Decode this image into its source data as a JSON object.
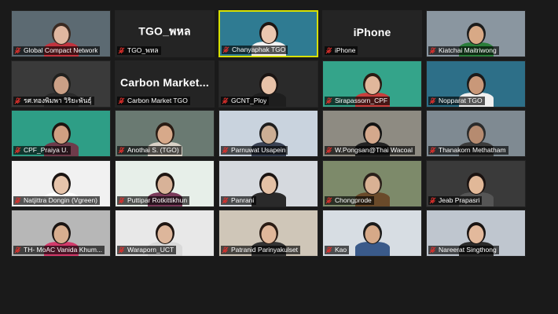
{
  "meeting": {
    "participants": [
      {
        "name": "Global Compact Network",
        "type": "video",
        "bg": "#5c6a72",
        "skin": "#e0b7a0",
        "hair": "#3a2a22",
        "shirt": "#c2333e",
        "muted": true
      },
      {
        "name": "TGO_พหล",
        "type": "name",
        "display": "TGO_พหล",
        "muted": true
      },
      {
        "name": "Chanyaphak TGO",
        "type": "video",
        "bg": "#2f7b92",
        "skin": "#eac7b0",
        "hair": "#1d1512",
        "shirt": "#f2f2f2",
        "muted": true,
        "speaking": true
      },
      {
        "name": "iPhone",
        "type": "name",
        "display": "iPhone",
        "muted": true
      },
      {
        "name": "Kiatchai Maitriwong",
        "type": "video",
        "bg": "#8a96a0",
        "skin": "#d8a986",
        "hair": "#1c1c1c",
        "shirt": "#2a7e3a",
        "muted": true
      },
      {
        "name": "รศ.ทองพิมพา วิริยะพันธุ์",
        "type": "video",
        "bg": "#3a3a3a",
        "skin": "#cba086",
        "hair": "#20201e",
        "shirt": "#2a2a2a",
        "muted": true
      },
      {
        "name": "Carbon Market TGO",
        "type": "name",
        "display": "Carbon  Market...",
        "muted": true
      },
      {
        "name": "GCNT_Ploy",
        "type": "video",
        "bg": "#2a2a2a",
        "skin": "#e8c2a8",
        "hair": "#1a1412",
        "shirt": "#1e1e1e",
        "muted": true
      },
      {
        "name": "Sirapassorn_CPF",
        "type": "video",
        "bg": "#34a48a",
        "skin": "#e1b79b",
        "hair": "#2a1a12",
        "shirt": "#c9403d",
        "muted": true
      },
      {
        "name": "Nopparat TGO",
        "type": "video",
        "bg": "#2d6f88",
        "skin": "#c99879",
        "hair": "#1a1a1a",
        "shirt": "#efefef",
        "muted": true
      },
      {
        "name": "CPF_Praiya U.",
        "type": "video",
        "bg": "#2e9e86",
        "skin": "#cf9f82",
        "hair": "#1c1410",
        "shirt": "#6e3b4b",
        "muted": true
      },
      {
        "name": "Anothai S. (TGO)",
        "type": "video",
        "bg": "#6a7a72",
        "skin": "#d7a98a",
        "hair": "#2a1c14",
        "shirt": "#d9d2c7",
        "muted": true
      },
      {
        "name": "Parnuwat Usapein",
        "type": "video",
        "bg": "#c9d3de",
        "skin": "#ccae94",
        "hair": "#1e1e1e",
        "shirt": "#3a4254",
        "muted": true
      },
      {
        "name": "W.Pongsan@Thai Wacoal",
        "type": "video",
        "bg": "#8e8b82",
        "skin": "#d4a88c",
        "hair": "#121212",
        "shirt": "#222222",
        "muted": true
      },
      {
        "name": "Thanakorn Methatham",
        "type": "video",
        "bg": "#7f8a92",
        "skin": "#b68b70",
        "hair": "#2b2b2b",
        "shirt": "#3b3b3b",
        "muted": true
      },
      {
        "name": "Natjittra Dongin (Vgreen)",
        "type": "video",
        "bg": "#f1f1f1",
        "skin": "#e6c4ab",
        "hair": "#1a1412",
        "shirt": "#ffffff",
        "muted": true
      },
      {
        "name": "Puttipar Rotkittikhun",
        "type": "video",
        "bg": "#e7efe9",
        "skin": "#d8b298",
        "hair": "#1f1612",
        "shirt": "#7a3a5a",
        "muted": true
      },
      {
        "name": "Panrani",
        "type": "video",
        "bg": "#d5d9de",
        "skin": "#e4c1a5",
        "hair": "#1a1412",
        "shirt": "#2a2a2a",
        "muted": true
      },
      {
        "name": "Chongprode",
        "type": "video",
        "bg": "#7d8a6a",
        "skin": "#d9b194",
        "hair": "#2a201a",
        "shirt": "#6a4a2a",
        "muted": true
      },
      {
        "name": "Jeab Prapasri",
        "type": "video",
        "bg": "#3a3a3a",
        "skin": "#e1b898",
        "hair": "#1a1210",
        "shirt": "#555555",
        "muted": true
      },
      {
        "name": "TH- MoAC Vanida Khum...",
        "type": "video",
        "bg": "#b7b7b7",
        "skin": "#d8ae8f",
        "hair": "#1a1412",
        "shirt": "#d23a6a",
        "muted": true
      },
      {
        "name": "Waraporn_UCT",
        "type": "video",
        "bg": "#e8e8e8",
        "skin": "#ddb69b",
        "hair": "#1f1612",
        "shirt": "#d9d9d9",
        "muted": true
      },
      {
        "name": "Patranid Parinyakulset",
        "type": "video",
        "bg": "#cfc6b8",
        "skin": "#e0b79a",
        "hair": "#2a1c14",
        "shirt": "#333333",
        "muted": true
      },
      {
        "name": "Kao",
        "type": "video",
        "bg": "#d7dde3",
        "skin": "#d6a988",
        "hair": "#1a1a1a",
        "shirt": "#3a5a8a",
        "muted": true
      },
      {
        "name": "Nareerat Singthong",
        "type": "video",
        "bg": "#bfc6cf",
        "skin": "#e3b99c",
        "hair": "#1a1412",
        "shirt": "#2a2a2a",
        "muted": true
      }
    ],
    "colors": {
      "speaking_border": "#d8e000",
      "muted_icon": "#e0302c",
      "tile_bg": "#242424",
      "app_bg": "#1a1a1a"
    }
  }
}
